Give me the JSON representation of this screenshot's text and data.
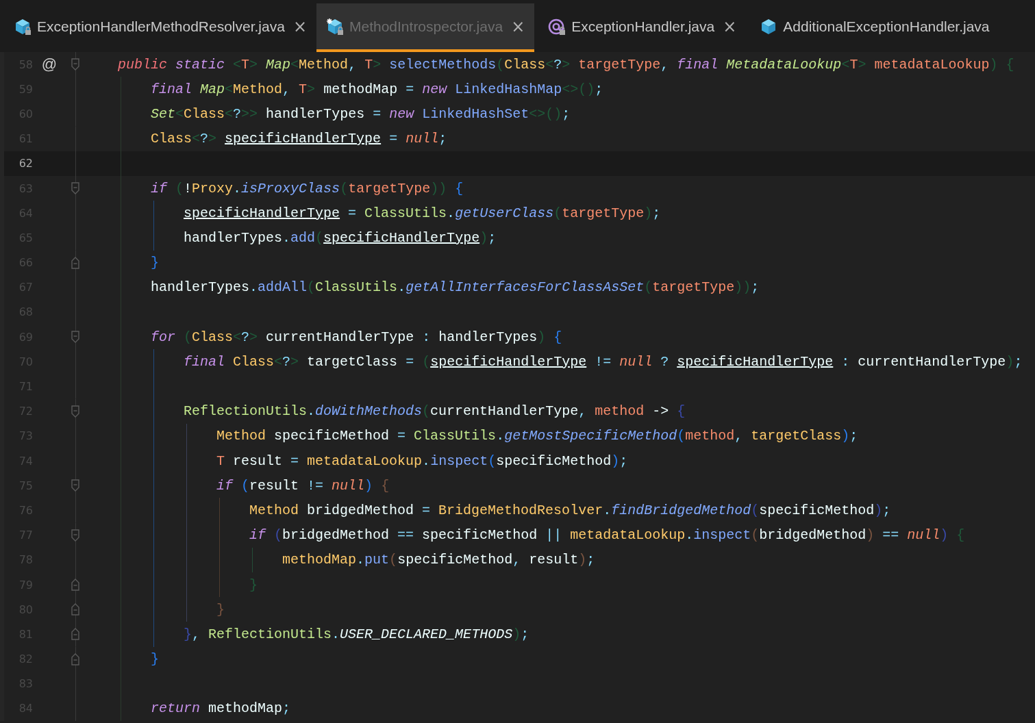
{
  "tabs": [
    {
      "label": "ExceptionHandlerMethodResolver.java",
      "kind": "class",
      "locked": true,
      "starred": false,
      "close": "×",
      "selected": false
    },
    {
      "label": "MethodIntrospector.java",
      "kind": "class",
      "locked": true,
      "starred": true,
      "close": "×",
      "selected": true
    },
    {
      "label": "ExceptionHandler.java",
      "kind": "annotation",
      "locked": true,
      "starred": false,
      "close": "×",
      "selected": false
    },
    {
      "label": "AdditionalExceptionHandler.java",
      "kind": "class",
      "locked": false,
      "starred": false,
      "selected": false
    }
  ],
  "lines": [
    {
      "number": "58",
      "annotation": "@",
      "kind": "opener",
      "current": false,
      "tokens": [
        {
          "kind": "mod",
          "text": "    public "
        },
        {
          "kind": "kw",
          "text": "static "
        },
        {
          "kind": "brace1",
          "text": "<"
        },
        {
          "kind": "tp",
          "text": "T"
        },
        {
          "kind": "brace1",
          "text": "> "
        },
        {
          "kind": "iface",
          "text": "Map"
        },
        {
          "kind": "brace1",
          "text": "<"
        },
        {
          "kind": "cls",
          "text": "Method"
        },
        {
          "kind": "op",
          "text": ", "
        },
        {
          "kind": "tp",
          "text": "T"
        },
        {
          "kind": "brace1",
          "text": "> "
        },
        {
          "kind": "call",
          "text": "selectMethods"
        },
        {
          "kind": "brace1",
          "text": "("
        },
        {
          "kind": "cls",
          "text": "Class"
        },
        {
          "kind": "brace1",
          "text": "<"
        },
        {
          "kind": "op",
          "text": "?"
        },
        {
          "kind": "brace1",
          "text": "> "
        },
        {
          "kind": "param",
          "text": "targetType"
        },
        {
          "kind": "op",
          "text": ", "
        },
        {
          "kind": "kw",
          "text": "final "
        },
        {
          "kind": "iface",
          "text": "MetadataLookup"
        },
        {
          "kind": "brace1",
          "text": "<"
        },
        {
          "kind": "tp",
          "text": "T"
        },
        {
          "kind": "brace1",
          "text": "> "
        },
        {
          "kind": "param",
          "text": "metadataLookup"
        },
        {
          "kind": "brace1",
          "text": ") {"
        }
      ]
    },
    {
      "number": "59",
      "current": false,
      "tokens": [
        {
          "kind": "kw",
          "text": "        final "
        },
        {
          "kind": "iface",
          "text": "Map"
        },
        {
          "kind": "brace1",
          "text": "<"
        },
        {
          "kind": "cls",
          "text": "Method"
        },
        {
          "kind": "op",
          "text": ", "
        },
        {
          "kind": "tp",
          "text": "T"
        },
        {
          "kind": "brace1",
          "text": "> "
        },
        {
          "kind": "var",
          "text": "methodMap "
        },
        {
          "kind": "op",
          "text": "= "
        },
        {
          "kind": "kw",
          "text": "new "
        },
        {
          "kind": "call",
          "text": "LinkedHashMap"
        },
        {
          "kind": "brace1",
          "text": "<>()"
        },
        {
          "kind": "op",
          "text": ";"
        }
      ]
    },
    {
      "number": "60",
      "current": false,
      "tokens": [
        {
          "kind": "iface",
          "text": "        Set"
        },
        {
          "kind": "brace1",
          "text": "<"
        },
        {
          "kind": "cls",
          "text": "Class"
        },
        {
          "kind": "brace1",
          "text": "<"
        },
        {
          "kind": "op",
          "text": "?"
        },
        {
          "kind": "brace1",
          "text": ">> "
        },
        {
          "kind": "var",
          "text": "handlerTypes "
        },
        {
          "kind": "op",
          "text": "= "
        },
        {
          "kind": "kw",
          "text": "new "
        },
        {
          "kind": "call",
          "text": "LinkedHashSet"
        },
        {
          "kind": "brace1",
          "text": "<>()"
        },
        {
          "kind": "op",
          "text": ";"
        }
      ]
    },
    {
      "number": "61",
      "current": false,
      "tokens": [
        {
          "kind": "cls",
          "text": "        Class"
        },
        {
          "kind": "brace1",
          "text": "<"
        },
        {
          "kind": "op",
          "text": "?"
        },
        {
          "kind": "brace1",
          "text": "> "
        },
        {
          "kind": "field",
          "text": "specificHandlerType"
        },
        {
          "kind": "op",
          "text": " = "
        },
        {
          "kind": "nul",
          "text": "null"
        },
        {
          "kind": "op",
          "text": ";"
        }
      ]
    },
    {
      "number": "62",
      "current": true
    },
    {
      "number": "63",
      "kind": "opener",
      "current": false,
      "tokens": [
        {
          "kind": "kw",
          "text": "        if "
        },
        {
          "kind": "brace1",
          "text": "("
        },
        {
          "kind": "var",
          "text": "!"
        },
        {
          "kind": "cls",
          "text": "Proxy"
        },
        {
          "kind": "op",
          "text": "."
        },
        {
          "kind": "scall",
          "text": "isProxyClass"
        },
        {
          "kind": "brace1",
          "text": "("
        },
        {
          "kind": "param",
          "text": "targetType"
        },
        {
          "kind": "brace1",
          "text": ")) "
        },
        {
          "kind": "brace2",
          "text": "{"
        }
      ]
    },
    {
      "number": "64",
      "current": false,
      "tokens": [
        {
          "kind": "field",
          "text": "            specificHandlerType"
        },
        {
          "kind": "op",
          "text": " = "
        },
        {
          "kind": "util",
          "text": "ClassUtils"
        },
        {
          "kind": "op",
          "text": "."
        },
        {
          "kind": "scall",
          "text": "getUserClass"
        },
        {
          "kind": "brace1",
          "text": "("
        },
        {
          "kind": "param",
          "text": "targetType"
        },
        {
          "kind": "brace1",
          "text": ")"
        },
        {
          "kind": "op",
          "text": ";"
        }
      ]
    },
    {
      "number": "65",
      "current": false,
      "tokens": [
        {
          "kind": "var",
          "text": "            handlerTypes"
        },
        {
          "kind": "op",
          "text": "."
        },
        {
          "kind": "call",
          "text": "add"
        },
        {
          "kind": "brace1",
          "text": "("
        },
        {
          "kind": "field",
          "text": "specificHandlerType"
        },
        {
          "kind": "brace1",
          "text": ")"
        },
        {
          "kind": "op",
          "text": ";"
        }
      ]
    },
    {
      "number": "66",
      "kind": "closer",
      "current": false,
      "tokens": [
        {
          "kind": "brace2",
          "text": "        }"
        }
      ]
    },
    {
      "number": "67",
      "current": false,
      "tokens": [
        {
          "kind": "var",
          "text": "        handlerTypes"
        },
        {
          "kind": "op",
          "text": "."
        },
        {
          "kind": "call",
          "text": "addAll"
        },
        {
          "kind": "brace1",
          "text": "("
        },
        {
          "kind": "util",
          "text": "ClassUtils"
        },
        {
          "kind": "op",
          "text": "."
        },
        {
          "kind": "scall",
          "text": "getAllInterfacesForClassAsSet"
        },
        {
          "kind": "brace1",
          "text": "("
        },
        {
          "kind": "param",
          "text": "targetType"
        },
        {
          "kind": "brace1",
          "text": "))"
        },
        {
          "kind": "op",
          "text": ";"
        }
      ]
    },
    {
      "number": "68",
      "current": false
    },
    {
      "number": "69",
      "kind": "opener",
      "current": false,
      "tokens": [
        {
          "kind": "kw",
          "text": "        for "
        },
        {
          "kind": "brace1",
          "text": "("
        },
        {
          "kind": "cls",
          "text": "Class"
        },
        {
          "kind": "brace1",
          "text": "<"
        },
        {
          "kind": "op",
          "text": "?"
        },
        {
          "kind": "brace1",
          "text": "> "
        },
        {
          "kind": "var",
          "text": "currentHandlerType "
        },
        {
          "kind": "op",
          "text": ": "
        },
        {
          "kind": "var",
          "text": "handlerTypes"
        },
        {
          "kind": "brace1",
          "text": ") "
        },
        {
          "kind": "brace2",
          "text": "{"
        }
      ]
    },
    {
      "number": "70",
      "current": false,
      "tokens": [
        {
          "kind": "kw",
          "text": "            final "
        },
        {
          "kind": "cls",
          "text": "Class"
        },
        {
          "kind": "brace1",
          "text": "<"
        },
        {
          "kind": "op",
          "text": "?"
        },
        {
          "kind": "brace1",
          "text": "> "
        },
        {
          "kind": "var",
          "text": "targetClass "
        },
        {
          "kind": "op",
          "text": "= "
        },
        {
          "kind": "brace1",
          "text": "("
        },
        {
          "kind": "field",
          "text": "specificHandlerType"
        },
        {
          "kind": "op",
          "text": " != "
        },
        {
          "kind": "nul",
          "text": "null"
        },
        {
          "kind": "op",
          "text": " ? "
        },
        {
          "kind": "field",
          "text": "specificHandlerType"
        },
        {
          "kind": "op",
          "text": " : "
        },
        {
          "kind": "var",
          "text": "currentHandlerType"
        },
        {
          "kind": "brace1",
          "text": ")"
        },
        {
          "kind": "op",
          "text": ";"
        }
      ]
    },
    {
      "number": "71",
      "current": false
    },
    {
      "number": "72",
      "kind": "opener",
      "current": false,
      "tokens": [
        {
          "kind": "util",
          "text": "            ReflectionUtils"
        },
        {
          "kind": "op",
          "text": "."
        },
        {
          "kind": "scall",
          "text": "doWithMethods"
        },
        {
          "kind": "brace1",
          "text": "("
        },
        {
          "kind": "var",
          "text": "currentHandlerType"
        },
        {
          "kind": "op",
          "text": ", "
        },
        {
          "kind": "param",
          "text": "method "
        },
        {
          "kind": "var",
          "text": "-> "
        },
        {
          "kind": "brace3",
          "text": "{"
        }
      ]
    },
    {
      "number": "73",
      "current": false,
      "tokens": [
        {
          "kind": "cls",
          "text": "                Method "
        },
        {
          "kind": "var",
          "text": "specificMethod "
        },
        {
          "kind": "op",
          "text": "= "
        },
        {
          "kind": "util",
          "text": "ClassUtils"
        },
        {
          "kind": "op",
          "text": "."
        },
        {
          "kind": "scall",
          "text": "getMostSpecificMethod"
        },
        {
          "kind": "brace2",
          "text": "("
        },
        {
          "kind": "param",
          "text": "method"
        },
        {
          "kind": "op",
          "text": ", "
        },
        {
          "kind": "cls",
          "text": "targetClass"
        },
        {
          "kind": "brace2",
          "text": ")"
        },
        {
          "kind": "op",
          "text": ";"
        }
      ]
    },
    {
      "number": "74",
      "current": false,
      "tokens": [
        {
          "kind": "tp",
          "text": "                T "
        },
        {
          "kind": "var",
          "text": "result "
        },
        {
          "kind": "op",
          "text": "= "
        },
        {
          "kind": "cls",
          "text": "metadataLookup"
        },
        {
          "kind": "op",
          "text": "."
        },
        {
          "kind": "call",
          "text": "inspect"
        },
        {
          "kind": "brace2",
          "text": "("
        },
        {
          "kind": "var",
          "text": "specificMethod"
        },
        {
          "kind": "brace2",
          "text": ")"
        },
        {
          "kind": "op",
          "text": ";"
        }
      ]
    },
    {
      "number": "75",
      "kind": "opener",
      "current": false,
      "tokens": [
        {
          "kind": "kw",
          "text": "                if "
        },
        {
          "kind": "brace2",
          "text": "("
        },
        {
          "kind": "var",
          "text": "result "
        },
        {
          "kind": "op",
          "text": "!= "
        },
        {
          "kind": "nul",
          "text": "null"
        },
        {
          "kind": "brace2",
          "text": ") "
        },
        {
          "kind": "brace4",
          "text": "{"
        }
      ]
    },
    {
      "number": "76",
      "current": false,
      "tokens": [
        {
          "kind": "cls",
          "text": "                    Method "
        },
        {
          "kind": "var",
          "text": "bridgedMethod "
        },
        {
          "kind": "op",
          "text": "= "
        },
        {
          "kind": "cls",
          "text": "BridgeMethodResolver"
        },
        {
          "kind": "op",
          "text": "."
        },
        {
          "kind": "scall",
          "text": "findBridgedMethod"
        },
        {
          "kind": "brace3",
          "text": "("
        },
        {
          "kind": "var",
          "text": "specificMethod"
        },
        {
          "kind": "brace3",
          "text": ")"
        },
        {
          "kind": "op",
          "text": ";"
        }
      ]
    },
    {
      "number": "77",
      "kind": "opener",
      "current": false,
      "tokens": [
        {
          "kind": "kw",
          "text": "                    if "
        },
        {
          "kind": "brace3",
          "text": "("
        },
        {
          "kind": "var",
          "text": "bridgedMethod "
        },
        {
          "kind": "op",
          "text": "== "
        },
        {
          "kind": "var",
          "text": "specificMethod "
        },
        {
          "kind": "op",
          "text": "|| "
        },
        {
          "kind": "cls",
          "text": "metadataLookup"
        },
        {
          "kind": "op",
          "text": "."
        },
        {
          "kind": "call",
          "text": "inspect"
        },
        {
          "kind": "brace4",
          "text": "("
        },
        {
          "kind": "var",
          "text": "bridgedMethod"
        },
        {
          "kind": "brace4",
          "text": ") "
        },
        {
          "kind": "op",
          "text": "== "
        },
        {
          "kind": "nul",
          "text": "null"
        },
        {
          "kind": "brace3",
          "text": ") "
        },
        {
          "kind": "brace1",
          "text": "{"
        }
      ]
    },
    {
      "number": "78",
      "current": false,
      "tokens": [
        {
          "kind": "cls",
          "text": "                        methodMap"
        },
        {
          "kind": "op",
          "text": "."
        },
        {
          "kind": "call",
          "text": "put"
        },
        {
          "kind": "brace4",
          "text": "("
        },
        {
          "kind": "var",
          "text": "specificMethod"
        },
        {
          "kind": "op",
          "text": ", "
        },
        {
          "kind": "var",
          "text": "result"
        },
        {
          "kind": "brace4",
          "text": ")"
        },
        {
          "kind": "op",
          "text": ";"
        }
      ]
    },
    {
      "number": "79",
      "kind": "closer",
      "current": false,
      "tokens": [
        {
          "kind": "brace1",
          "text": "                    }"
        }
      ]
    },
    {
      "number": "80",
      "kind": "closer",
      "current": false,
      "tokens": [
        {
          "kind": "brace4",
          "text": "                }"
        }
      ]
    },
    {
      "number": "81",
      "kind": "closer",
      "current": false,
      "tokens": [
        {
          "kind": "brace3",
          "text": "            }"
        },
        {
          "kind": "op",
          "text": ", "
        },
        {
          "kind": "util",
          "text": "ReflectionUtils"
        },
        {
          "kind": "op",
          "text": "."
        },
        {
          "kind": "const",
          "text": "USER_DECLARED_METHODS"
        },
        {
          "kind": "brace1",
          "text": ")"
        },
        {
          "kind": "op",
          "text": ";"
        }
      ]
    },
    {
      "number": "82",
      "kind": "closer",
      "current": false,
      "tokens": [
        {
          "kind": "brace2",
          "text": "        }"
        }
      ]
    },
    {
      "number": "83",
      "current": false
    },
    {
      "number": "84",
      "current": false,
      "tokens": [
        {
          "kind": "kw",
          "text": "        return "
        },
        {
          "kind": "var",
          "text": "methodMap"
        },
        {
          "kind": "op",
          "text": ";"
        }
      ]
    }
  ]
}
